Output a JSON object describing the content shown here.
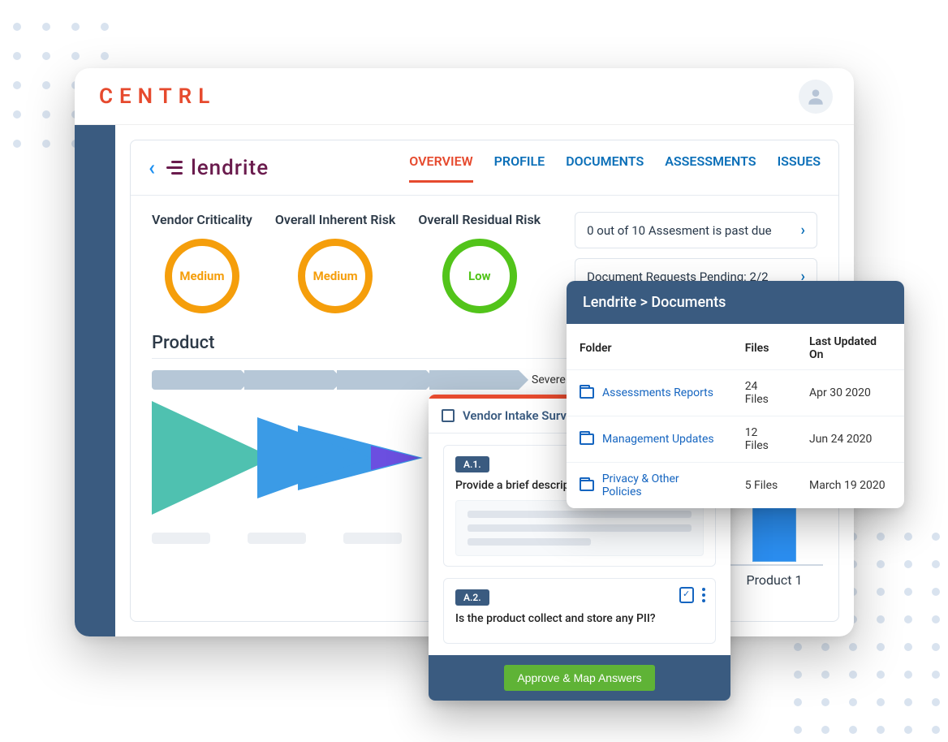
{
  "brand": "CENTRL",
  "vendor_name": "lendrite",
  "tabs": [
    "OVERVIEW",
    "PROFILE",
    "DOCUMENTS",
    "ASSESSMENTS",
    "ISSUES"
  ],
  "active_tab": "OVERVIEW",
  "metrics": [
    {
      "label": "Vendor Criticality",
      "value": "Medium",
      "level": "medium"
    },
    {
      "label": "Overall Inherent Risk",
      "value": "Medium",
      "level": "medium"
    },
    {
      "label": "Overall Residual Risk",
      "value": "Low",
      "level": "low"
    }
  ],
  "alerts": [
    "0 out of 10 Assesment is past due",
    "Document Requests Pending: 2/2"
  ],
  "section_title": "Product",
  "severe_label": "Severe",
  "bar_label": "Product 1",
  "documents_card": {
    "title": "Lendrite > Documents",
    "columns": [
      "Folder",
      "Files",
      "Last Updated On"
    ],
    "rows": [
      {
        "folder": "Assessments Reports",
        "files": "24 Files",
        "updated": "Apr 30 2020"
      },
      {
        "folder": "Management Updates",
        "files": "12 Files",
        "updated": "Jun 24 2020"
      },
      {
        "folder": "Privacy & Other Policies",
        "files": "5 Files",
        "updated": "March 19 2020"
      }
    ]
  },
  "survey_card": {
    "title": "Vendor Intake Survey",
    "questions": [
      {
        "tag": "A.1.",
        "text": "Provide a brief description of the product."
      },
      {
        "tag": "A.2.",
        "text": "Is the product collect and store any PII?"
      }
    ],
    "approve_label": "Approve & Map Answers"
  },
  "chart_data": {
    "type": "bar",
    "categories": [
      "Product 1"
    ],
    "values": [
      1
    ],
    "title": "",
    "xlabel": "",
    "ylabel": "",
    "ylim": [
      0,
      1
    ]
  }
}
